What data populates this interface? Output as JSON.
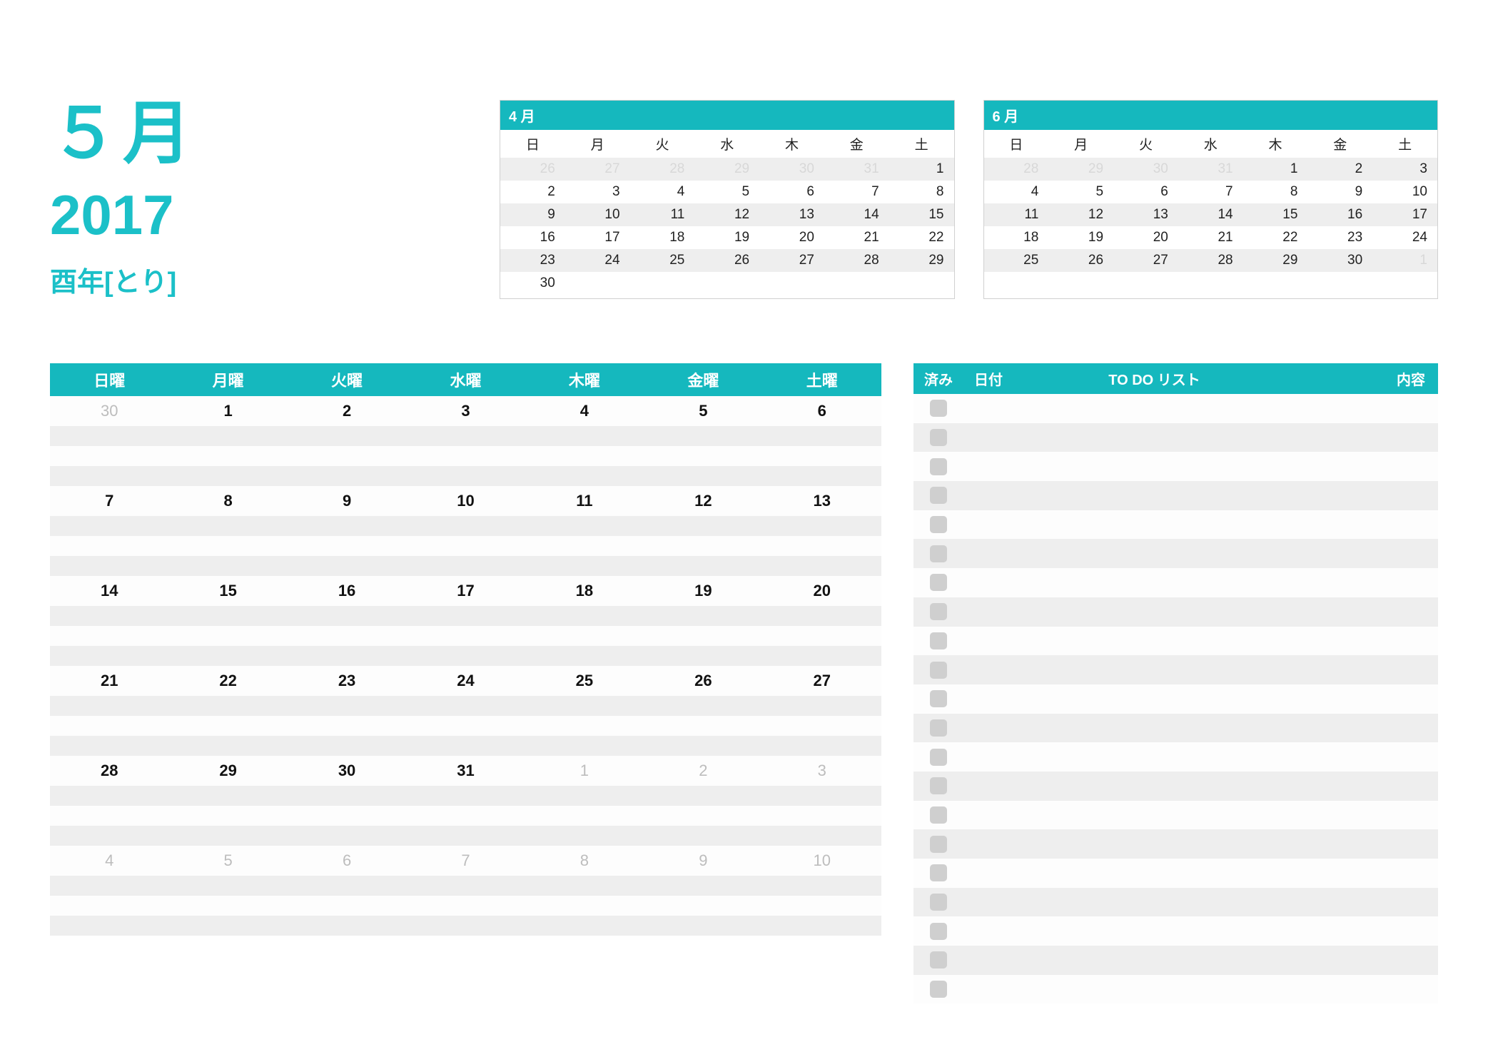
{
  "accent": "#15b8be",
  "title": {
    "month": "５月",
    "year": "2017",
    "zodiac": "酉年[とり]"
  },
  "mini_day_headers": [
    "日",
    "月",
    "火",
    "水",
    "木",
    "金",
    "土"
  ],
  "mini_prev": {
    "label": "4 月",
    "rows": [
      [
        {
          "v": "26",
          "dim": true
        },
        {
          "v": "27",
          "dim": true
        },
        {
          "v": "28",
          "dim": true
        },
        {
          "v": "29",
          "dim": true
        },
        {
          "v": "30",
          "dim": true
        },
        {
          "v": "31",
          "dim": true
        },
        {
          "v": "1"
        }
      ],
      [
        {
          "v": "2"
        },
        {
          "v": "3"
        },
        {
          "v": "4"
        },
        {
          "v": "5"
        },
        {
          "v": "6"
        },
        {
          "v": "7"
        },
        {
          "v": "8"
        }
      ],
      [
        {
          "v": "9"
        },
        {
          "v": "10"
        },
        {
          "v": "11"
        },
        {
          "v": "12"
        },
        {
          "v": "13"
        },
        {
          "v": "14"
        },
        {
          "v": "15"
        }
      ],
      [
        {
          "v": "16"
        },
        {
          "v": "17"
        },
        {
          "v": "18"
        },
        {
          "v": "19"
        },
        {
          "v": "20"
        },
        {
          "v": "21"
        },
        {
          "v": "22"
        }
      ],
      [
        {
          "v": "23"
        },
        {
          "v": "24"
        },
        {
          "v": "25"
        },
        {
          "v": "26"
        },
        {
          "v": "27"
        },
        {
          "v": "28"
        },
        {
          "v": "29"
        }
      ],
      [
        {
          "v": "30"
        },
        {
          "v": ""
        },
        {
          "v": ""
        },
        {
          "v": ""
        },
        {
          "v": ""
        },
        {
          "v": ""
        },
        {
          "v": ""
        }
      ]
    ]
  },
  "mini_next": {
    "label": "6 月",
    "rows": [
      [
        {
          "v": "28",
          "dim": true
        },
        {
          "v": "29",
          "dim": true
        },
        {
          "v": "30",
          "dim": true
        },
        {
          "v": "31",
          "dim": true
        },
        {
          "v": "1"
        },
        {
          "v": "2"
        },
        {
          "v": "3"
        }
      ],
      [
        {
          "v": "4"
        },
        {
          "v": "5"
        },
        {
          "v": "6"
        },
        {
          "v": "7"
        },
        {
          "v": "8"
        },
        {
          "v": "9"
        },
        {
          "v": "10"
        }
      ],
      [
        {
          "v": "11"
        },
        {
          "v": "12"
        },
        {
          "v": "13"
        },
        {
          "v": "14"
        },
        {
          "v": "15"
        },
        {
          "v": "16"
        },
        {
          "v": "17"
        }
      ],
      [
        {
          "v": "18"
        },
        {
          "v": "19"
        },
        {
          "v": "20"
        },
        {
          "v": "21"
        },
        {
          "v": "22"
        },
        {
          "v": "23"
        },
        {
          "v": "24"
        }
      ],
      [
        {
          "v": "25"
        },
        {
          "v": "26"
        },
        {
          "v": "27"
        },
        {
          "v": "28"
        },
        {
          "v": "29"
        },
        {
          "v": "30"
        },
        {
          "v": "1",
          "dim": true
        }
      ]
    ]
  },
  "main_day_headers": [
    "日曜",
    "月曜",
    "火曜",
    "水曜",
    "木曜",
    "金曜",
    "土曜"
  ],
  "main_weeks": [
    [
      {
        "v": "30",
        "dim": true
      },
      {
        "v": "1"
      },
      {
        "v": "2"
      },
      {
        "v": "3"
      },
      {
        "v": "4"
      },
      {
        "v": "5"
      },
      {
        "v": "6"
      }
    ],
    [
      {
        "v": "7"
      },
      {
        "v": "8"
      },
      {
        "v": "9"
      },
      {
        "v": "10"
      },
      {
        "v": "11"
      },
      {
        "v": "12"
      },
      {
        "v": "13"
      }
    ],
    [
      {
        "v": "14"
      },
      {
        "v": "15"
      },
      {
        "v": "16"
      },
      {
        "v": "17"
      },
      {
        "v": "18"
      },
      {
        "v": "19"
      },
      {
        "v": "20"
      }
    ],
    [
      {
        "v": "21"
      },
      {
        "v": "22"
      },
      {
        "v": "23"
      },
      {
        "v": "24"
      },
      {
        "v": "25"
      },
      {
        "v": "26"
      },
      {
        "v": "27"
      }
    ],
    [
      {
        "v": "28"
      },
      {
        "v": "29"
      },
      {
        "v": "30"
      },
      {
        "v": "31"
      },
      {
        "v": "1",
        "dim": true
      },
      {
        "v": "2",
        "dim": true
      },
      {
        "v": "3",
        "dim": true
      }
    ],
    [
      {
        "v": "4",
        "dim": true
      },
      {
        "v": "5",
        "dim": true
      },
      {
        "v": "6",
        "dim": true
      },
      {
        "v": "7",
        "dim": true
      },
      {
        "v": "8",
        "dim": true
      },
      {
        "v": "9",
        "dim": true
      },
      {
        "v": "10",
        "dim": true
      }
    ]
  ],
  "todo": {
    "headers": {
      "done": "済み",
      "date": "日付",
      "list": "TO DO リスト",
      "content": "内容"
    },
    "row_count": 21
  }
}
